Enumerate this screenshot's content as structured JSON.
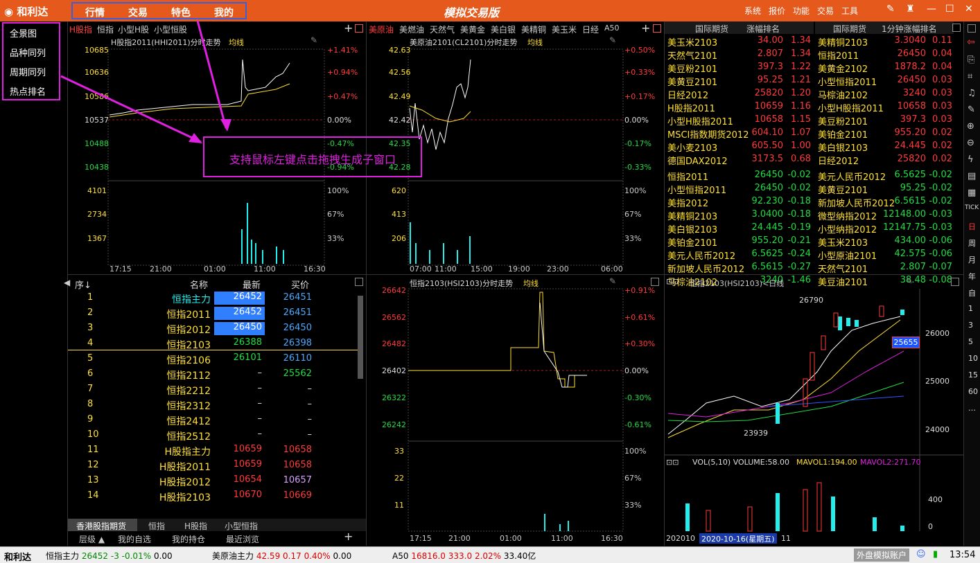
{
  "app": {
    "logo": "和利达",
    "title": "模拟交易版",
    "menu": [
      "行情",
      "交易",
      "特色",
      "我的"
    ],
    "sys": [
      "系统",
      "报价",
      "功能",
      "交易",
      "工具"
    ]
  },
  "left_nav": [
    "全景图",
    "品种同列",
    "周期同列",
    "热点排名"
  ],
  "annotation": "支持鼠标左键点击拖拽生成子窗口",
  "chart1": {
    "tabs": [
      "H股指",
      "恒指",
      "小型H股",
      "小型恒股"
    ],
    "title": "H股指2011(HHI2011)分时走势",
    "avg": "均线",
    "y_left": [
      "10685",
      "10636",
      "10586",
      "10537",
      "10488",
      "10438"
    ],
    "y_right": [
      "+1.41%",
      "+0.94%",
      "+0.47%",
      "0.00%",
      "-0.47%",
      "-0.94%"
    ],
    "vol_left": [
      "4101",
      "2734",
      "1367"
    ],
    "vol_right": [
      "100%",
      "67%",
      "33%"
    ],
    "x": [
      "17:15",
      "21:00",
      "01:00",
      "11:00",
      "16:30"
    ]
  },
  "chart2": {
    "tabs": [
      "美原油",
      "美燃油",
      "天然气",
      "美黄金",
      "美白银",
      "美精铜",
      "美玉米",
      "日经",
      "A50"
    ],
    "title": "美原油2101(CL2101)分时走势",
    "avg": "均线",
    "y_left": [
      "42.63",
      "42.56",
      "42.49",
      "42.42",
      "42.35",
      "42.28"
    ],
    "y_right": [
      "+0.50%",
      "+0.33%",
      "+0.17%",
      "0.00%",
      "-0.17%",
      "-0.33%"
    ],
    "vol_left": [
      "620",
      "413",
      "206"
    ],
    "vol_right": [
      "100%",
      "67%",
      "33%"
    ],
    "x": [
      "07:00",
      "11:00",
      "15:00",
      "19:00",
      "23:00",
      "06:00"
    ]
  },
  "chart3": {
    "title": "恒指2103(HSI2103)分时走势",
    "avg": "均线",
    "y_left": [
      "26642",
      "26562",
      "26482",
      "26402",
      "26322",
      "26242"
    ],
    "y_right": [
      "+0.91%",
      "+0.61%",
      "+0.30%",
      "0.00%",
      "-0.30%",
      "-0.61%"
    ],
    "vol_left": [
      "33",
      "22",
      "11"
    ],
    "vol_right": [
      "100%",
      "67%",
      "33%"
    ],
    "x": [
      "17:15",
      "21:00",
      "01:00",
      "11:00",
      "16:30"
    ]
  },
  "rank": {
    "h1": [
      "国际期货",
      "涨幅排名"
    ],
    "h2": [
      "国际期货",
      "1分钟涨幅排名"
    ],
    "left": [
      [
        "美玉米2103",
        "34.00",
        "1.34"
      ],
      [
        "天然气2101",
        "2.807",
        "1.34"
      ],
      [
        "美豆粉2101",
        "397.3",
        "1.22"
      ],
      [
        "美黄豆2101",
        "95.25",
        "1.21"
      ],
      [
        "日经2012",
        "25820",
        "1.20"
      ],
      [
        "H股指2011",
        "10659",
        "1.16"
      ],
      [
        "小型H股指2011",
        "10658",
        "1.15"
      ],
      [
        "MSCI指数期货2012",
        "604.10",
        "1.07"
      ],
      [
        "美小麦2103",
        "605.50",
        "1.00"
      ],
      [
        "德国DAX2012",
        "3173.5",
        "0.68"
      ],
      [
        "恒指2011",
        "26450",
        "-0.02"
      ],
      [
        "小型恒指2011",
        "26450",
        "-0.02"
      ],
      [
        "美指2012",
        "92.230",
        "-0.18"
      ],
      [
        "美精铜2103",
        "3.0400",
        "-0.18"
      ],
      [
        "美白银2103",
        "24.445",
        "-0.19"
      ],
      [
        "美铂金2101",
        "955.20",
        "-0.21"
      ],
      [
        "美元人民币2012",
        "6.5625",
        "-0.24"
      ],
      [
        "新加坡人民币2012",
        "6.5615",
        "-0.27"
      ],
      [
        "马棕油2102",
        "3240",
        "-1.46"
      ]
    ],
    "right": [
      [
        "美精铜2103",
        "3.3040",
        "0.11"
      ],
      [
        "恒指2011",
        "26450",
        "0.04"
      ],
      [
        "美黄金2102",
        "1878.2",
        "0.04"
      ],
      [
        "小型恒指2011",
        "26450",
        "0.03"
      ],
      [
        "马棕油2102",
        "3240",
        "0.03"
      ],
      [
        "小型H股指2011",
        "10658",
        "0.03"
      ],
      [
        "美豆粉2101",
        "397.3",
        "0.03"
      ],
      [
        "美铂金2101",
        "955.20",
        "0.02"
      ],
      [
        "美白银2103",
        "24.445",
        "0.02"
      ],
      [
        "日经2012",
        "25820",
        "0.02"
      ],
      [
        "美元人民币2012",
        "6.5625",
        "-0.02"
      ],
      [
        "美黄豆2101",
        "95.25",
        "-0.02"
      ],
      [
        "新加坡人民币2012",
        "6.5615",
        "-0.02"
      ],
      [
        "微型纳指2012",
        "12148.00",
        "-0.03"
      ],
      [
        "小型纳指2012",
        "12147.75",
        "-0.03"
      ],
      [
        "美玉米2103",
        "434.00",
        "-0.06"
      ],
      [
        "小型原油2101",
        "42.575",
        "-0.06"
      ],
      [
        "天然气2101",
        "2.807",
        "-0.07"
      ],
      [
        "美豆油2101",
        "38.48",
        "-0.08"
      ]
    ]
  },
  "table": {
    "headers": [
      "序",
      "名称",
      "最新",
      "买价"
    ],
    "rows": [
      [
        "1",
        "恒指主力",
        "26452",
        "26451"
      ],
      [
        "2",
        "恒指2011",
        "26452",
        "26451"
      ],
      [
        "3",
        "恒指2012",
        "26450",
        "26450"
      ],
      [
        "4",
        "恒指2103",
        "26388",
        "26398"
      ],
      [
        "5",
        "恒指2106",
        "26101",
        "26110"
      ],
      [
        "6",
        "恒指2112",
        "–",
        "25562"
      ],
      [
        "7",
        "恒指2212",
        "–",
        "–"
      ],
      [
        "8",
        "恒指2312",
        "–",
        "–"
      ],
      [
        "9",
        "恒指2412",
        "–",
        "–"
      ],
      [
        "10",
        "恒指2512",
        "–",
        "–"
      ],
      [
        "11",
        "H股指主力",
        "10659",
        "10658"
      ],
      [
        "12",
        "H股指2011",
        "10659",
        "10658"
      ],
      [
        "13",
        "H股指2012",
        "10654",
        "10657"
      ],
      [
        "14",
        "H股指2103",
        "10670",
        "10669"
      ]
    ],
    "tabs": [
      "香港股指期货",
      "恒指",
      "H股指",
      "小型恒指"
    ],
    "bottom": [
      "层级 ▲",
      "我的自选",
      "我的持仓",
      "最近浏览"
    ]
  },
  "kline": {
    "title": "恒指2103(HSI2103)<日线",
    "hi": "26790",
    "lo": "23939",
    "last": "25655",
    "y": [
      "26000",
      "25000",
      "24000"
    ],
    "vol_title": "VOL(5,10) VOLUME:58.00",
    "mavol1": "MAVOL1:194.00",
    "mavol2": "MAVOL2:271.70",
    "vol_y": [
      "400",
      "0"
    ],
    "date1": "202010",
    "date2": "2020-10-16(星期五)",
    "date3": "11"
  },
  "sidebar": [
    "TICK",
    "日",
    "周",
    "月",
    "年",
    "自",
    "1",
    "3",
    "5",
    "10",
    "15",
    "60",
    "…"
  ],
  "status": {
    "logo": "和利达",
    "items": [
      {
        "name": "恒指主力",
        "price": "26452",
        "chg": "-3",
        "pct": "-0.01%",
        "vol": "0.00"
      },
      {
        "name": "美原油主力",
        "price": "42.59",
        "chg": "0.17",
        "pct": "0.40%",
        "vol": "0.00"
      },
      {
        "name": "A50",
        "price": "16816.0",
        "chg": "333.0",
        "pct": "2.02%",
        "vol": "33.40亿"
      }
    ],
    "acct": "外盘模拟账户",
    "time": "13:54"
  }
}
